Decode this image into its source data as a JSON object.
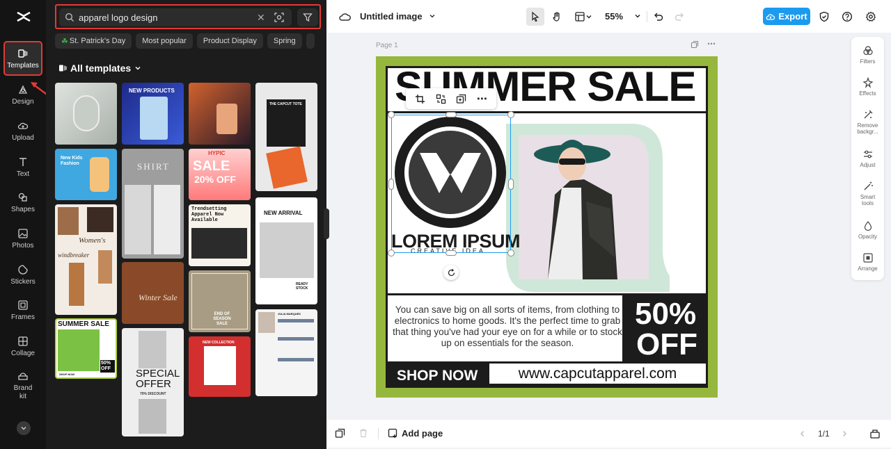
{
  "rail": {
    "items": [
      {
        "label": "Templates"
      },
      {
        "label": "Design"
      },
      {
        "label": "Upload"
      },
      {
        "label": "Text"
      },
      {
        "label": "Shapes"
      },
      {
        "label": "Photos"
      },
      {
        "label": "Stickers"
      },
      {
        "label": "Frames"
      },
      {
        "label": "Collage"
      },
      {
        "label": "Brand kit"
      }
    ]
  },
  "panel": {
    "search_value": "apparel logo design",
    "chips": [
      "St. Patrick's Day",
      "Most popular",
      "Product Display",
      "Spring"
    ],
    "all_templates_label": "All templates",
    "thumbs": {
      "new_products": "NEW PRODUCTS",
      "new_kids": "New Kids Fashion",
      "shirt": "SHIRT",
      "hypic": "HYPIC",
      "sale20_1": "SALE",
      "sale20_2": "20% OFF",
      "capcut_tote": "THE CAPCUT TOTE",
      "womens": "Women's",
      "windbreaker": "windbreaker",
      "trendsetting": "Trendsetting Apparel Now Available",
      "new_arrival": "NEW ARRIVAL",
      "ready_stock": "READY STOCK",
      "winter_sale": "Winter Sale",
      "end_season": "END OF SEASON SALE",
      "summer_sale": "SUMMER SALE",
      "summer_pct": "50% OFF",
      "shop_now_small": "SHOP NOW",
      "special_offer": "SPECIAL OFFER",
      "discount70": "70% DISCOUNT",
      "new_collection": "NEW COLLECTION",
      "julia": "JULIA MARQUES"
    }
  },
  "topbar": {
    "doc_title": "Untitled image",
    "zoom": "55%",
    "export_label": "Export"
  },
  "canvas": {
    "page_label": "Page 1",
    "headline": "SUMMER SALE",
    "logo_text": "LOREM IPSUM",
    "logo_sub": "CREATIVE IDEA",
    "body_text": "You can save big on all sorts of items, from clothing to electronics to home goods. It's the perfect time to grab that thing you've had your eye on for a while or to stock up on essentials for the season.",
    "pct": "50%",
    "off": "OFF",
    "shop_now": "SHOP NOW",
    "url": "www.capcutapparel.com"
  },
  "right_tools": [
    {
      "label": "Filters"
    },
    {
      "label": "Effects"
    },
    {
      "label": "Remove backgr..."
    },
    {
      "label": "Adjust"
    },
    {
      "label": "Smart tools"
    },
    {
      "label": "Opacity"
    },
    {
      "label": "Arrange"
    }
  ],
  "bottombar": {
    "add_page": "Add page",
    "page_count": "1/1"
  },
  "colors": {
    "accent": "#1a9bf0",
    "highlight": "#e53935",
    "border_green": "#96b73d"
  }
}
